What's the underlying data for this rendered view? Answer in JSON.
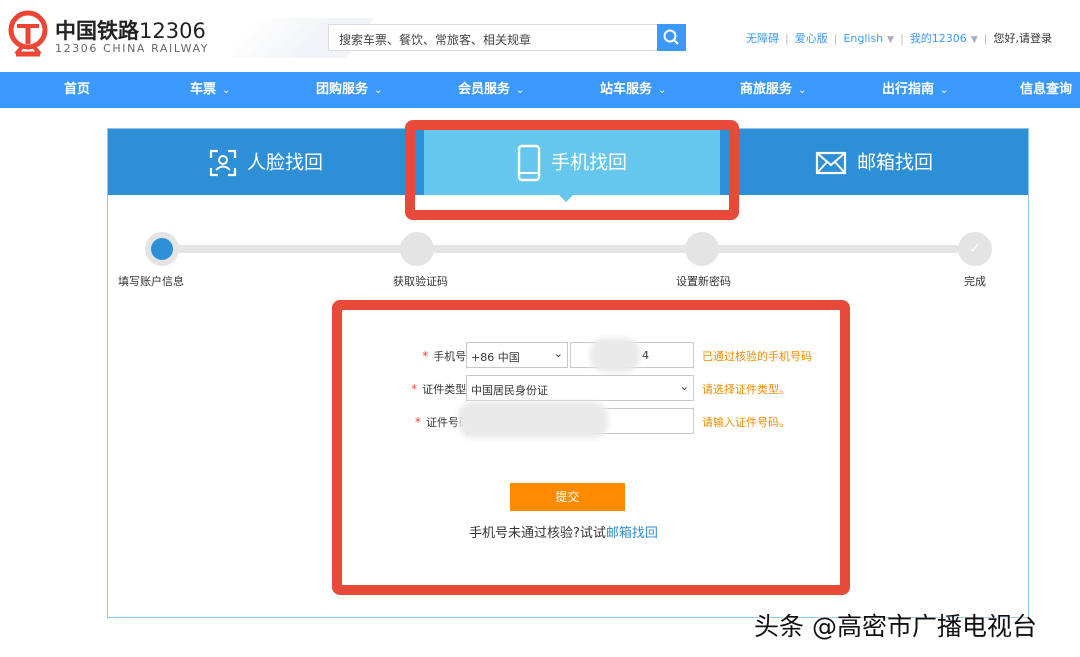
{
  "header": {
    "logo_title_cn": "中国铁路",
    "logo_title_num": "12306",
    "logo_subtitle": "12306 CHINA RAILWAY",
    "search_placeholder": "搜索车票、餐饮、常旅客、相关规章",
    "links": {
      "barrier_free": "无障碍",
      "care_version": "爱心版",
      "english": "English",
      "my_12306": "我的12306",
      "login_prompt": "您好,请登录"
    }
  },
  "nav": {
    "items": [
      {
        "label": "首页",
        "dropdown": false
      },
      {
        "label": "车票",
        "dropdown": true
      },
      {
        "label": "团购服务",
        "dropdown": true
      },
      {
        "label": "会员服务",
        "dropdown": true
      },
      {
        "label": "站车服务",
        "dropdown": true
      },
      {
        "label": "商旅服务",
        "dropdown": true
      },
      {
        "label": "出行指南",
        "dropdown": true
      },
      {
        "label": "信息查询",
        "dropdown": false
      }
    ]
  },
  "tabs": {
    "face": "人脸找回",
    "phone": "手机找回",
    "email": "邮箱找回"
  },
  "steps": [
    "填写账户信息",
    "获取验证码",
    "设置新密码",
    "完成"
  ],
  "form": {
    "phone_label": "手机号:",
    "country_code": "+86 中国",
    "phone_value_tail": "4",
    "phone_hint": "已通过核验的手机号码",
    "id_type_label": "证件类型:",
    "id_type_value": "中国居民身份证",
    "id_type_hint": "请选择证件类型。",
    "id_number_label": "证件号码",
    "id_number_hint": "请输入证件号码。",
    "submit_label": "提交",
    "fallback_text": "手机号未通过核验?试试",
    "fallback_link": "邮箱找回"
  },
  "watermark": "头条 @高密市广播电视台",
  "colors": {
    "brand_blue": "#3b99fc",
    "tab_blue": "#2d8fd5",
    "tab_active": "#66c7ee",
    "accent_orange": "#ff8a00",
    "highlight_red": "#e84a3a",
    "logo_red": "#e43"
  }
}
